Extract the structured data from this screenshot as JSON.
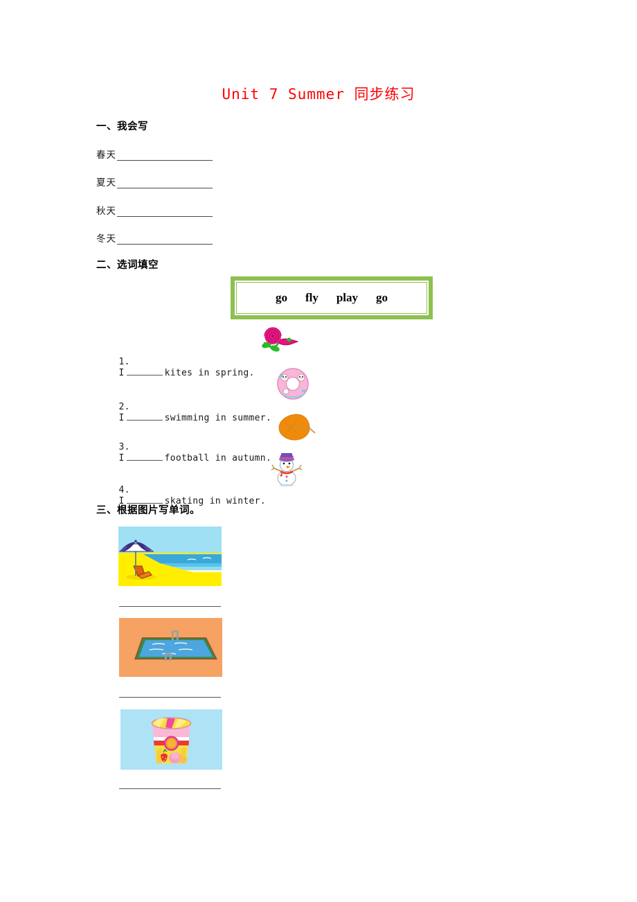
{
  "document": {
    "title": "Unit 7 Summer 同步练习",
    "title_color": "#fe0000"
  },
  "section1": {
    "heading": "一、我会写",
    "items": [
      {
        "label": "春天",
        "answer_blank": ""
      },
      {
        "label": "夏天",
        "answer_blank": ""
      },
      {
        "label": "秋天",
        "answer_blank": ""
      },
      {
        "label": "冬天",
        "answer_blank": ""
      }
    ]
  },
  "section2": {
    "heading": "二、选词填空",
    "word_bank": {
      "border_color": "#8dc050",
      "words": [
        "go",
        "fly",
        "play",
        "go"
      ]
    },
    "sentences": [
      {
        "number": "1.",
        "before": "I",
        "after": "kites in spring.",
        "icon": "rose-icon"
      },
      {
        "number": "2.",
        "before": "I",
        "after": "swimming in summer.",
        "icon": "swim-ring-icon"
      },
      {
        "number": "3.",
        "before": "I",
        "after": "football in autumn.",
        "icon": "autumn-leaf-icon"
      },
      {
        "number": "4.",
        "before": "I",
        "after": "skating in winter.",
        "icon": "snowman-icon"
      }
    ]
  },
  "section3": {
    "heading": "三、根据图片写单词。",
    "pictures": [
      {
        "name": "beach-picture",
        "answer_blank": ""
      },
      {
        "name": "swimming-pool-picture",
        "answer_blank": ""
      },
      {
        "name": "ice-cream-picture",
        "answer_blank": ""
      }
    ]
  },
  "colors": {
    "title_red": "#fe0000",
    "word_bank_green": "#8dc050",
    "beach_sky": "#9fe0f5",
    "beach_sand": "#ffee00",
    "pool_deck": "#f5a263",
    "pool_water": "#4da6dd",
    "icecream_bg": "#aee2f5"
  }
}
